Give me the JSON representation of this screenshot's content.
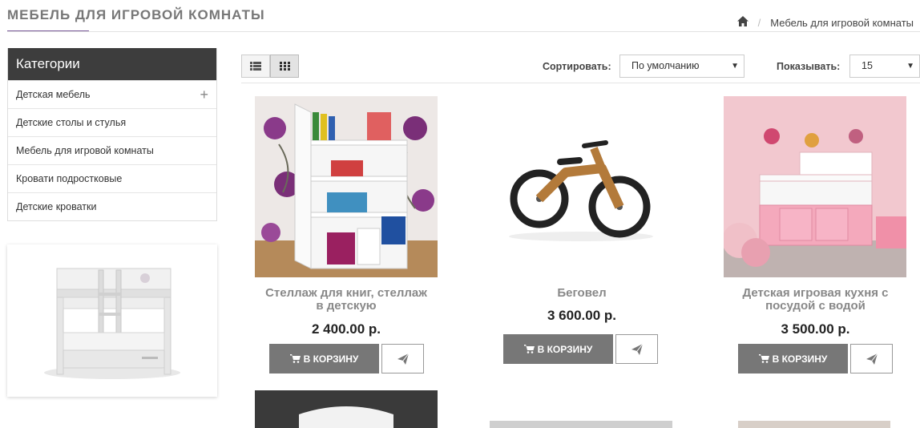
{
  "header": {
    "title": "МЕБЕЛЬ ДЛЯ ИГРОВОЙ КОМНАТЫ",
    "breadcrumb_separator": "/",
    "breadcrumb_current": "Мебель для игровой комнаты"
  },
  "sidebar": {
    "heading": "Категории",
    "items": [
      {
        "label": "Детская мебель",
        "expand": "+"
      },
      {
        "label": "Детские столы и стулья"
      },
      {
        "label": "Мебель для игровой комнаты"
      },
      {
        "label": "Кровати подростковые"
      },
      {
        "label": "Детские кроватки"
      }
    ]
  },
  "toolbar": {
    "sort_label": "Сортировать:",
    "sort_value": "По умолчанию",
    "show_label": "Показывать:",
    "show_value": "15"
  },
  "products": [
    {
      "name_line1": "Стеллаж для книг, стеллаж",
      "name_line2": "в детскую",
      "price": "2 400.00 р.",
      "cart_label": "В КОРЗИНУ"
    },
    {
      "name_line1": "Беговел",
      "price": "3 600.00 р.",
      "cart_label": "В КОРЗИНУ"
    },
    {
      "name_line1": "Детская игровая кухня с",
      "name_line2": "посудой с водой",
      "price": "3 500.00 р.",
      "cart_label": "В КОРЗИНУ"
    }
  ],
  "colors": {
    "accent": "#7a5a9a",
    "category_header": "#3d3d3d",
    "cart_button": "#777777"
  },
  "icons": [
    "home-icon",
    "list-view-icon",
    "grid-view-icon",
    "plus-icon",
    "cart-icon",
    "paper-plane-icon",
    "chevron-down-icon"
  ]
}
